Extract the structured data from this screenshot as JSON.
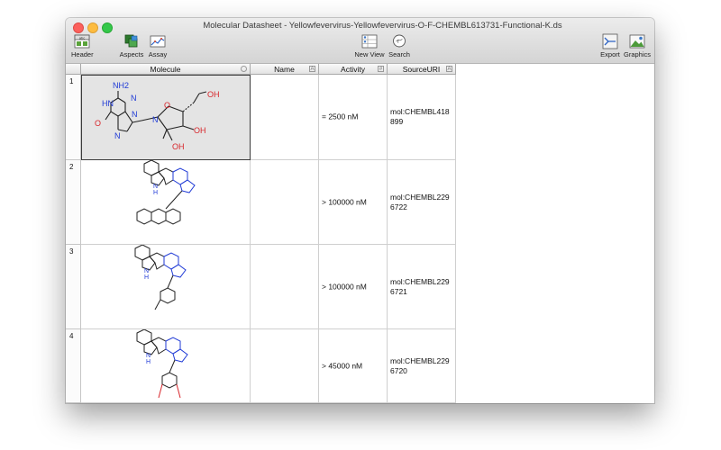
{
  "window": {
    "title": "Molecular Datasheet - Yellowfevervirus-Yellowfevervirus-O-F-CHEMBL613731-Functional-K.ds"
  },
  "toolbar": {
    "header_label": "Header",
    "aspects_label": "Aspects",
    "assay_label": "Assay",
    "newview_label": "New View",
    "search_label": "Search",
    "export_label": "Export",
    "graphics_label": "Graphics"
  },
  "columns": {
    "molecule": "Molecule",
    "name": "Name",
    "activity": "Activity",
    "source": "SourceURI"
  },
  "rows": [
    {
      "num": "1",
      "name": "",
      "activity": "= 2500 nM",
      "source": "mol:CHEMBL418899"
    },
    {
      "num": "2",
      "name": "",
      "activity": "> 100000 nM",
      "source": "mol:CHEMBL2296722"
    },
    {
      "num": "3",
      "name": "",
      "activity": "> 100000 nM",
      "source": "mol:CHEMBL2296721"
    },
    {
      "num": "4",
      "name": "",
      "activity": "> 45000 nM",
      "source": "mol:CHEMBL2296720"
    }
  ],
  "structure_labels": {
    "nh2": "NH2",
    "n": "N",
    "hn": "HN",
    "o": "O",
    "oh": "OH",
    "h": "H"
  },
  "colors": {
    "nitrogen": "#1f3ad6",
    "oxygen": "#d8262b",
    "bond": "#222222"
  }
}
